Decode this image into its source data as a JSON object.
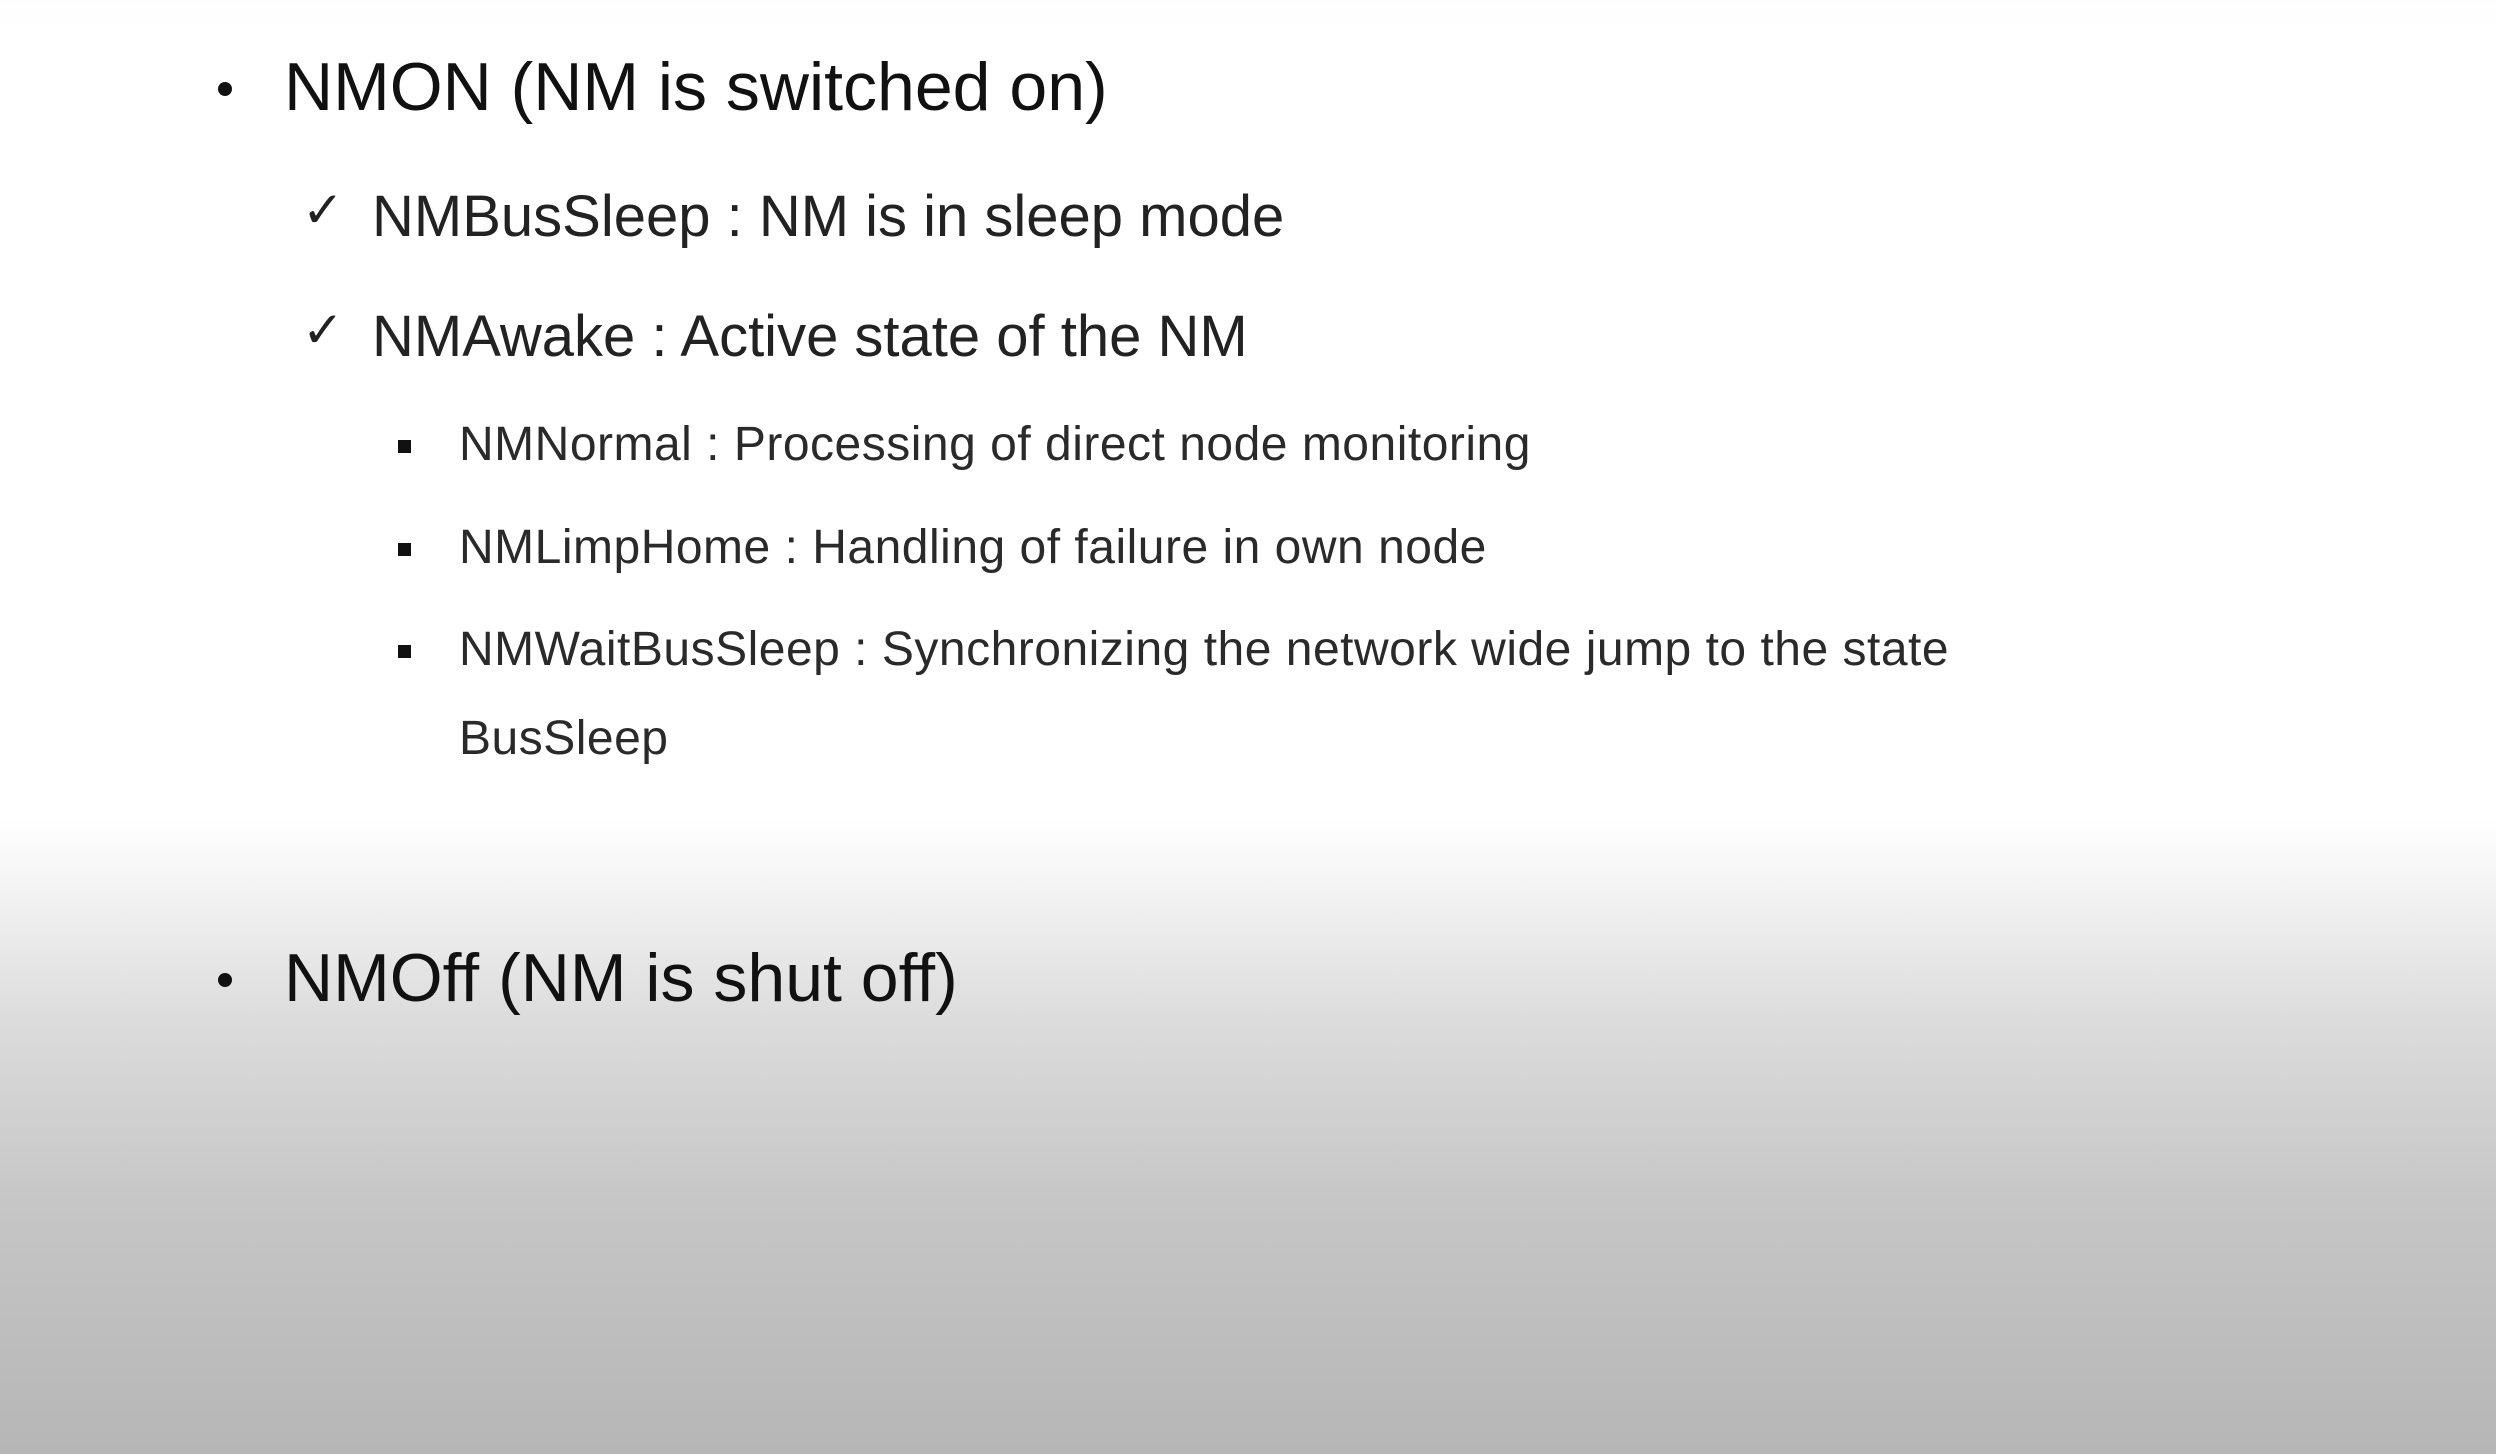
{
  "items": [
    {
      "text": "NMON (NM is switched on)",
      "marker": "bullet",
      "children": [
        {
          "text": "NMBusSleep : NM is in sleep mode",
          "marker": "checkmark"
        },
        {
          "text": "NMAwake : Active state of the NM",
          "marker": "checkmark",
          "children": [
            {
              "text": "NMNormal : Processing of direct node monitoring",
              "marker": "square"
            },
            {
              "text": "NMLimpHome : Handling of failure in own node",
              "marker": "square"
            },
            {
              "text_line1": "NMWaitBusSleep : Synchronizing the network wide jump to the state",
              "text_line2": "BusSleep",
              "marker": "square"
            }
          ]
        }
      ]
    },
    {
      "text": "NMOff (NM is shut off)",
      "marker": "bullet"
    }
  ],
  "icons": {
    "bullet": "bullet-dot-icon",
    "checkmark": "checkmark-icon",
    "square": "square-bullet-icon"
  }
}
